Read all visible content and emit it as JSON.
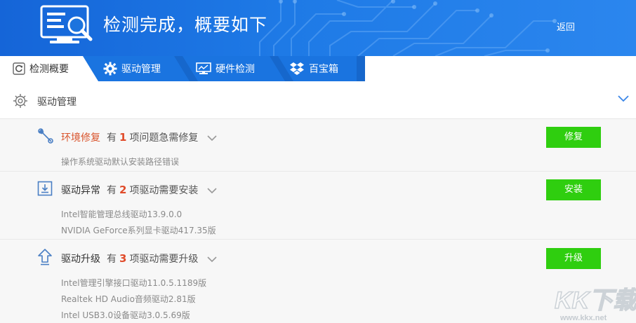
{
  "header": {
    "title": "检测完成，概要如下",
    "back_label": "返回"
  },
  "tabs": [
    {
      "label": "检测概要",
      "icon": "refresh-icon",
      "active": true
    },
    {
      "label": "驱动管理",
      "icon": "gear-icon",
      "active": false
    },
    {
      "label": "硬件检测",
      "icon": "monitor-icon",
      "active": false
    },
    {
      "label": "百宝箱",
      "icon": "dropbox-icon",
      "active": false
    }
  ],
  "section": {
    "title": "驱动管理"
  },
  "items": [
    {
      "name": "环境修复",
      "prefix": "有",
      "count": "1",
      "suffix": "项问题急需修复",
      "button": "修复",
      "details": [
        "操作系统驱动默认安装路径错误"
      ]
    },
    {
      "name": "驱动异常",
      "prefix": "有",
      "count": "2",
      "suffix": "项驱动需要安装",
      "button": "安装",
      "details": [
        "Intel智能管理总线驱动13.9.0.0",
        "NVIDIA GeForce系列显卡驱动417.35版"
      ]
    },
    {
      "name": "驱动升级",
      "prefix": "有",
      "count": "3",
      "suffix": "项驱动需要升级",
      "button": "升级",
      "details": [
        "Intel管理引擎接口驱动11.0.5.1189版",
        "Realtek HD Audio音频驱动2.81版",
        "Intel USB3.0设备驱动3.0.5.69版"
      ]
    }
  ],
  "watermark": {
    "text": "KK下载",
    "url": "www.kkx.net"
  },
  "colors": {
    "header_blue": "#1e7ae6",
    "tab_blue": "#1a74e0",
    "button_green": "#2fce0f",
    "alert_red": "#d9542c",
    "count_red": "#e04b2a"
  }
}
